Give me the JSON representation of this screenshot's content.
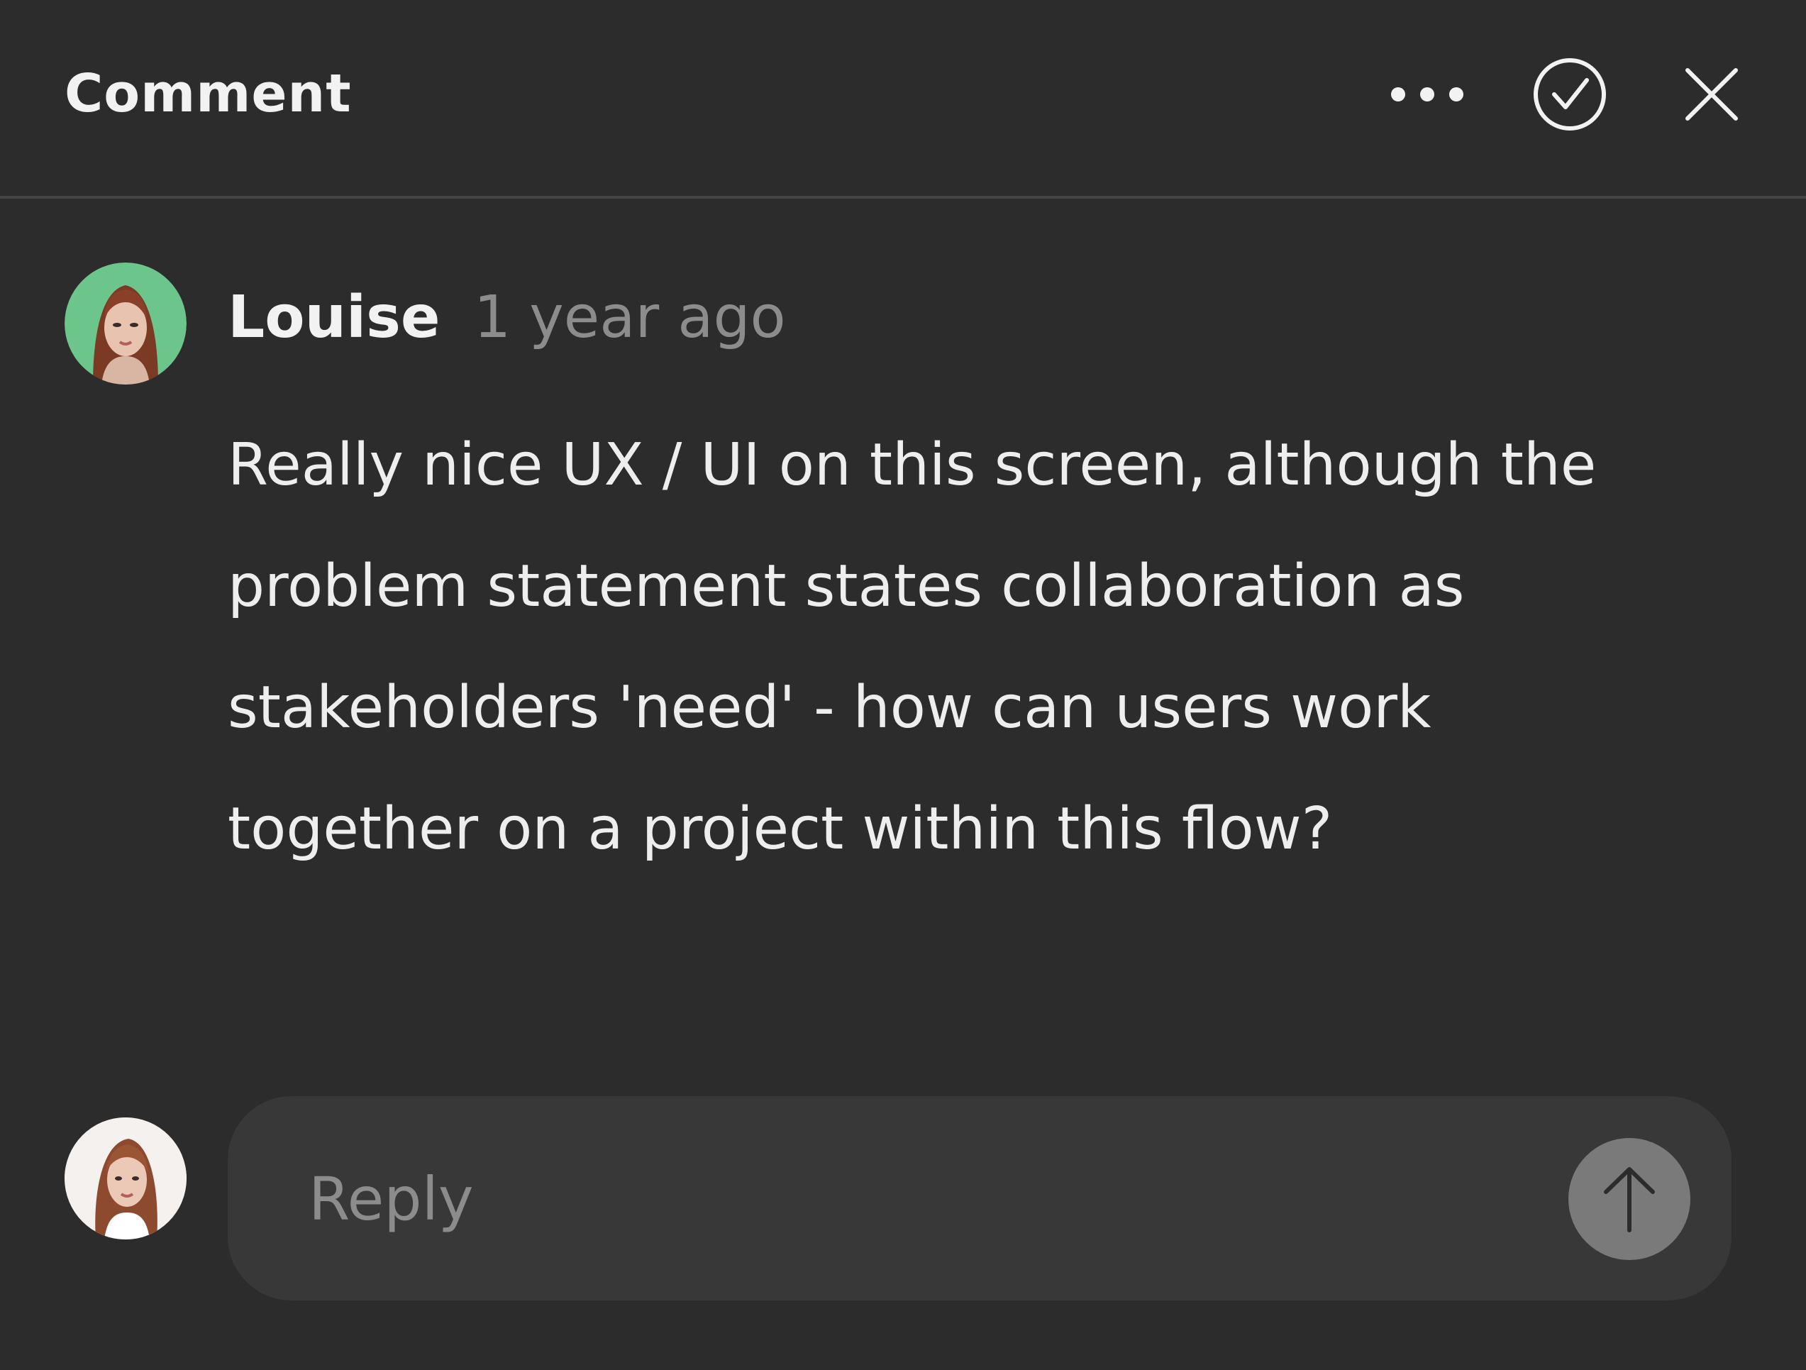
{
  "header": {
    "title": "Comment",
    "more_icon": "more-horizontal-icon",
    "resolve_icon": "check-circle-icon",
    "close_icon": "close-icon"
  },
  "comment": {
    "author": "Louise",
    "timestamp": "1 year ago",
    "body": "Really nice UX / UI on this screen, although the problem statement states collaboration as stakeholders 'need' - how can users work together on a project within this flow?",
    "avatar_bg": "#6cc58a"
  },
  "reply": {
    "placeholder": "Reply",
    "value": "",
    "send_icon": "arrow-up-icon"
  },
  "colors": {
    "background": "#2c2c2c",
    "reply_box": "#383838",
    "send_button": "#7a7a7a",
    "muted_text": "#8c8c8c"
  }
}
